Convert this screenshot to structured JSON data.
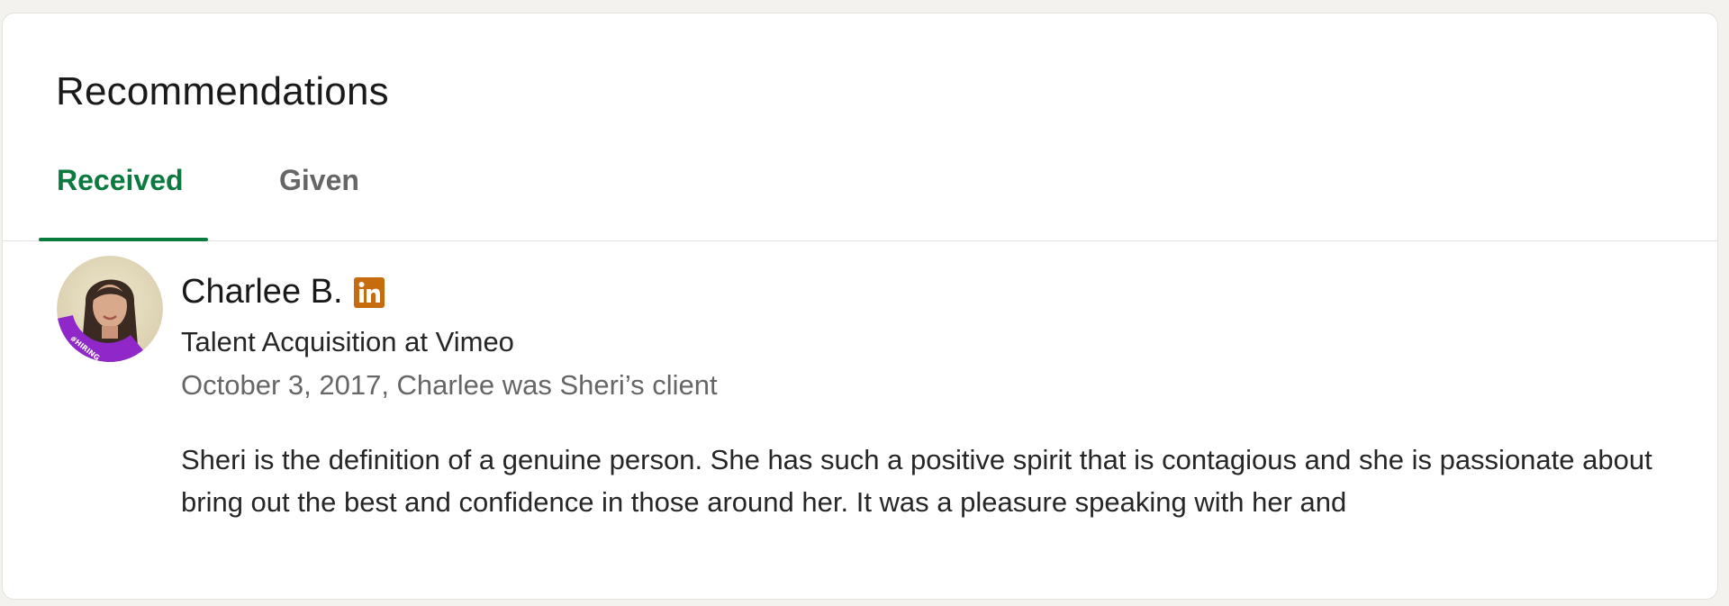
{
  "section": {
    "title": "Recommendations"
  },
  "tabs": [
    {
      "label": "Received",
      "active": true
    },
    {
      "label": "Given",
      "active": false
    }
  ],
  "colors": {
    "accent": "#0b7a3f",
    "linkedin_badge": "#c76b0f",
    "avatar_ring": "#8f27c9"
  },
  "recommendation": {
    "name": "Charlee B.",
    "badge_icon": "linkedin-icon",
    "badge_text": "in",
    "headline": "Talent Acquisition at Vimeo",
    "meta": "October 3, 2017, Charlee was Sheri’s client",
    "text": "Sheri is the definition of a genuine person. She has such a positive spirit that is contagious and she is passionate about bring out the best and confidence in those around her. It was a pleasure speaking with her and",
    "avatar_frame_text": "#HIRING"
  }
}
